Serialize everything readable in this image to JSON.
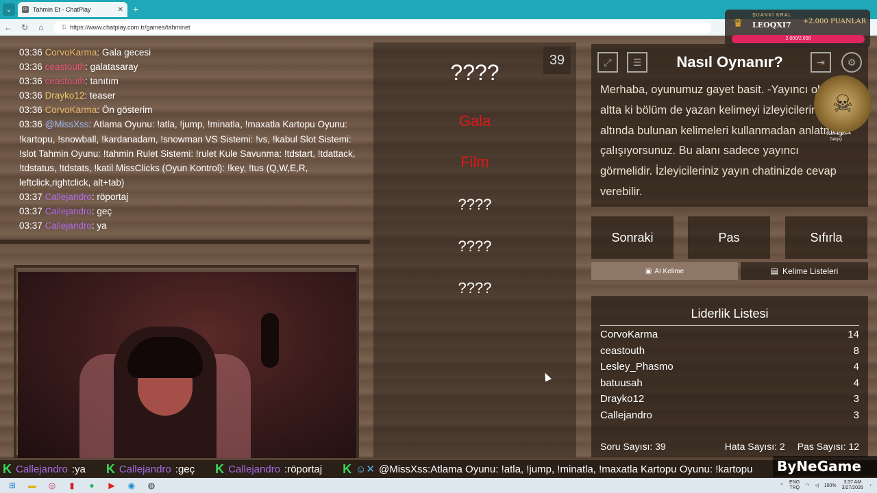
{
  "browser": {
    "tab_title": "Tahmin Et - ChatPlay",
    "tab_favicon": "CP",
    "url": "https://www.chatplay.com.tr/games/tahminet"
  },
  "chat": {
    "messages": [
      {
        "time": "03:36",
        "user": "CorvoKarma",
        "color": "#e8b86a",
        "text": ": Gala gecesi"
      },
      {
        "time": "03:36",
        "user": "ceastouth",
        "color": "#e0567a",
        "text": ": galatasaray"
      },
      {
        "time": "03:36",
        "user": "ceastouth",
        "color": "#e0567a",
        "text": ": tanıtım"
      },
      {
        "time": "03:36",
        "user": "Drayko12",
        "color": "#e8c86a",
        "text": ": teaser"
      },
      {
        "time": "03:36",
        "user": "CorvoKarma",
        "color": "#e8b86a",
        "text": ": Ön gösterim"
      },
      {
        "time": "03:36",
        "user": "@MissXss",
        "color": "#9ab8f0",
        "text": ": Atlama Oyunu: !atla, !jump, !minatla, !maxatla Kartopu Oyunu: !kartopu, !snowball, !kardanadam, !snowman VS Sistemi: !vs, !kabul Slot Sistemi: !slot Tahmin Oyunu: !tahmin Rulet Sistemi: !rulet Kule Savunma: !tdstart, !tdattack, !tdstatus, !tdstats, !katil MissClicks (Oyun Kontrol): !key, !tus (Q,W,E,R, leftclick,rightclick, alt+tab)"
      },
      {
        "time": "03:37",
        "user": "Callejandro",
        "color": "#b06ae8",
        "text": ": röportaj"
      },
      {
        "time": "03:37",
        "user": "Callejandro",
        "color": "#b06ae8",
        "text": ": geç"
      },
      {
        "time": "03:37",
        "user": "Callejandro",
        "color": "#b06ae8",
        "text": ": ya"
      }
    ]
  },
  "game": {
    "counter": "39",
    "words": [
      {
        "text": "????",
        "state": "hidden-main"
      },
      {
        "text": "Gala",
        "state": "revealed"
      },
      {
        "text": "Film",
        "state": "revealed"
      },
      {
        "text": "????",
        "state": "hidden"
      },
      {
        "text": "????",
        "state": "hidden"
      },
      {
        "text": "????",
        "state": "hidden"
      }
    ]
  },
  "how_to": {
    "title": "Nasıl Oynanır?",
    "text": "Merhaba, oyunumuz gayet basit. -Yayıncı olan sol altta ki bölüm de yazan kelimeyi izleyicilerinize altında bulunan kelimeleri kullanmadan anlatmaya çalışıyorsunuz. Bu alanı sadece yayıncı görmelidir. İzleyicileriniz yayın chatinizde cevap verebilir."
  },
  "actions": {
    "next": "Sonraki",
    "pass": "Pas",
    "reset": "Sıfırla",
    "get_word": "AI Kelime",
    "word_lists": "Kelime Listeleri"
  },
  "leaderboard": {
    "title": "Liderlik Listesi",
    "rows": [
      {
        "name": "CorvoKarma",
        "score": "14"
      },
      {
        "name": "ceastouth",
        "score": "8"
      },
      {
        "name": "Lesley_Phasmo",
        "score": "4"
      },
      {
        "name": "batuusah",
        "score": "4"
      },
      {
        "name": "Drayko12",
        "score": "3"
      },
      {
        "name": "Callejandro",
        "score": "3"
      }
    ],
    "stats": {
      "questions": "Soru Sayısı: 39",
      "errors": "Hata Sayısı: 2",
      "passes": "Pas Sayısı: 12"
    }
  },
  "overlay": {
    "badge_label": "ŞUANKİ KRAL",
    "badge_name": "LEOQXI7",
    "badge_points": "+2.000 PUANLAR",
    "badge_bar": "2.000/2.000",
    "skull_caption_1": "950 / 1000",
    "skull_caption_2": "Takipçi"
  },
  "ticker": {
    "items": [
      {
        "user": "Callejandro",
        "text": ":ya"
      },
      {
        "user": "Callejandro",
        "text": ":geç"
      },
      {
        "user": "Callejandro",
        "text": ":röportaj"
      }
    ],
    "bot_message": "@MissXss:Atlama Oyunu: !atla, !jump, !minatla, !maxatla Kartopu Oyunu: !kartopu",
    "brand": "ByNeGame"
  },
  "taskbar": {
    "lang": "ENG",
    "region": "TRQ",
    "battery": "100%",
    "time": "3:37 AM",
    "date": "3/27/2026"
  }
}
